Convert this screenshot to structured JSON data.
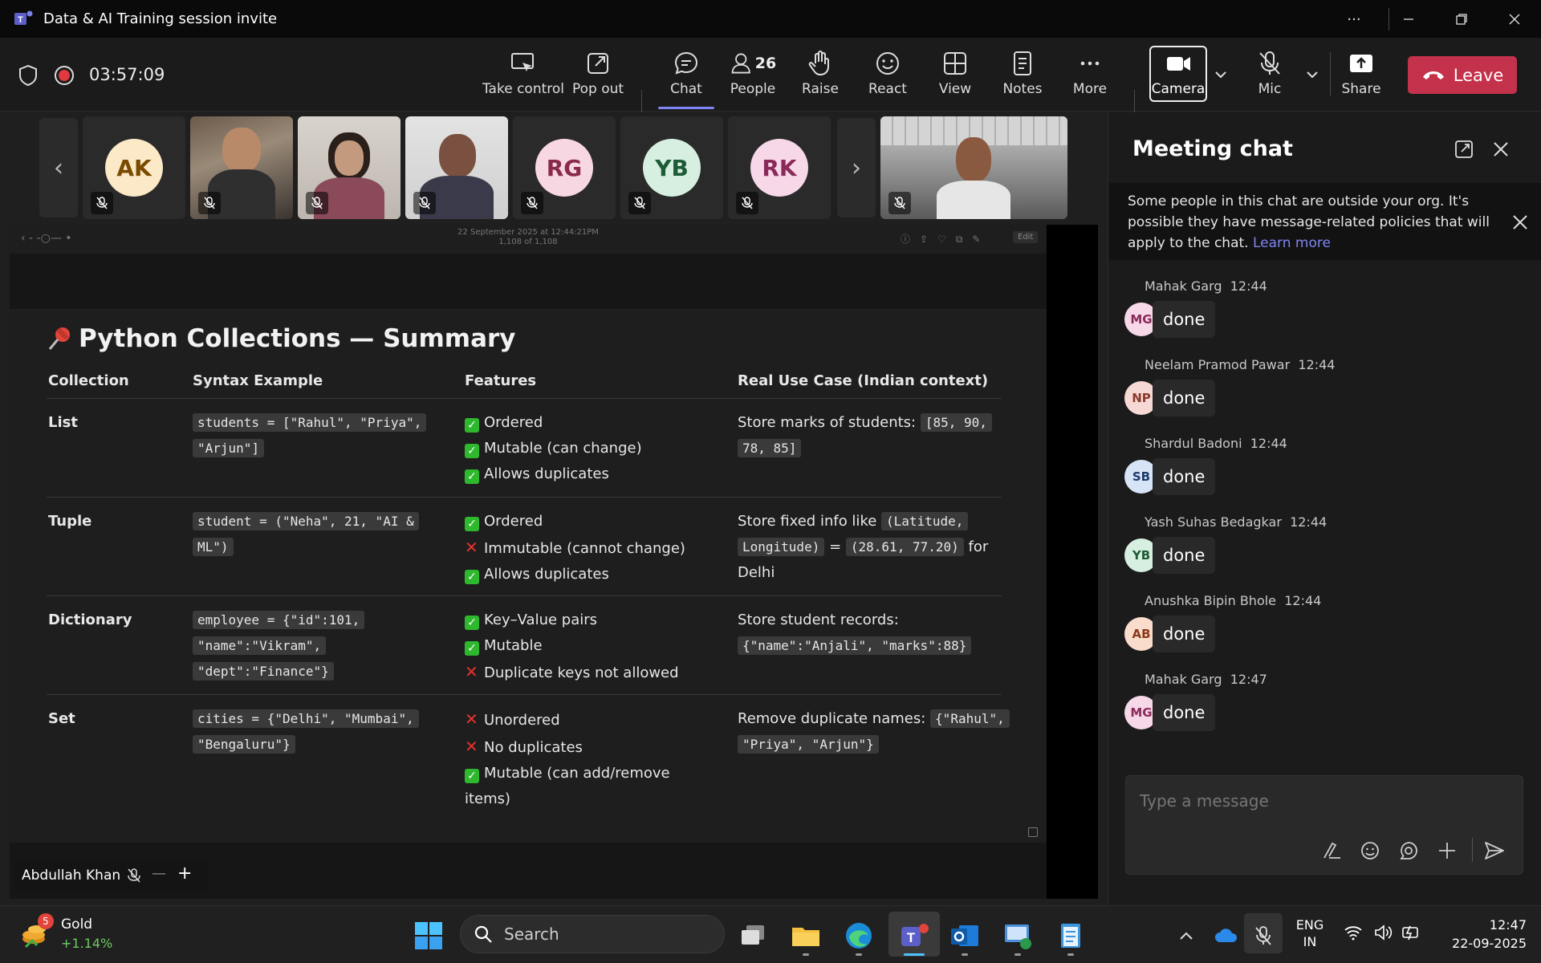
{
  "window": {
    "title": "Data & AI Training session invite"
  },
  "meeting": {
    "timer": "03:57:09",
    "toolbar": {
      "take_control": "Take control",
      "pop_out": "Pop out",
      "chat": "Chat",
      "people": "People",
      "people_count": "26",
      "raise": "Raise",
      "react": "React",
      "view": "View",
      "notes": "Notes",
      "more": "More",
      "camera": "Camera",
      "mic": "Mic",
      "share": "Share",
      "leave": "Leave"
    },
    "accent_color": "#7f85f5",
    "leave_color": "#c4314b"
  },
  "participants": [
    {
      "initials": "AK",
      "bg": "#fbe9c7",
      "fg": "#7a4a00",
      "type": "avatar"
    },
    {
      "initials": "",
      "type": "video"
    },
    {
      "initials": "",
      "type": "video"
    },
    {
      "initials": "",
      "type": "video"
    },
    {
      "initials": "RG",
      "bg": "#f7d8e2",
      "fg": "#8a2a4a",
      "type": "avatar"
    },
    {
      "initials": "YB",
      "bg": "#d6efe0",
      "fg": "#1d5a36",
      "type": "avatar"
    },
    {
      "initials": "RK",
      "bg": "#f7d8e8",
      "fg": "#8a2a5a",
      "type": "avatar"
    }
  ],
  "viewer": {
    "date_line1": "22 September 2025 at 12:44:21PM",
    "date_line2": "1,108 of 1,108",
    "edit": "Edit"
  },
  "slide": {
    "title": "Python Collections — Summary",
    "headers": [
      "Collection",
      "Syntax Example",
      "Features",
      "Real Use Case (Indian context)"
    ],
    "rows": [
      {
        "name": "List",
        "syntax": [
          "students = [\"Rahul\", \"Priya\",",
          "\"Arjun\"]"
        ],
        "features": [
          {
            "mark": "check",
            "text": "Ordered"
          },
          {
            "mark": "check",
            "text": "Mutable (can change)"
          },
          {
            "mark": "check",
            "text": "Allows duplicates"
          }
        ],
        "use_text": "Store marks of students:",
        "use_code1": "[85, 90,",
        "use_code2": "78, 85]"
      },
      {
        "name": "Tuple",
        "syntax": [
          "student = (\"Neha\", 21, \"AI &",
          "ML\")"
        ],
        "features": [
          {
            "mark": "check",
            "text": "Ordered"
          },
          {
            "mark": "cross",
            "text": "Immutable (cannot change)"
          },
          {
            "mark": "check",
            "text": "Allows duplicates"
          }
        ],
        "use_text": "Store fixed info like",
        "use_code1": "(Latitude,",
        "use_code2": "Longitude)",
        "use_eq": "=",
        "use_code3": "(28.61, 77.20)",
        "use_for": "for",
        "use_tail": "Delhi"
      },
      {
        "name": "Dictionary",
        "syntax": [
          "employee = {\"id\":101,",
          "\"name\":\"Vikram\",",
          "\"dept\":\"Finance\"}"
        ],
        "features": [
          {
            "mark": "check",
            "text": "Key–Value pairs"
          },
          {
            "mark": "check",
            "text": "Mutable"
          },
          {
            "mark": "cross",
            "text": "Duplicate keys not allowed"
          }
        ],
        "use_text": "Store student records:",
        "use_code1": "{\"name\":\"Anjali\", \"marks\":88}"
      },
      {
        "name": "Set",
        "syntax": [
          "cities = {\"Delhi\", \"Mumbai\",",
          "\"Bengaluru\"}"
        ],
        "features": [
          {
            "mark": "cross",
            "text": "Unordered"
          },
          {
            "mark": "cross",
            "text": "No duplicates"
          },
          {
            "mark": "check",
            "text": "Mutable (can add/remove"
          },
          {
            "mark": "none",
            "text": "items)"
          }
        ],
        "use_text": "Remove duplicate names:",
        "use_code1": "{\"Rahul\",",
        "use_code2": "\"Priya\", \"Arjun\"}"
      }
    ]
  },
  "presenter": {
    "name": "Abdullah Khan"
  },
  "chat": {
    "title": "Meeting chat",
    "notice": "Some people in this chat are outside your org. It's possible they have message-related policies that will apply to the chat.",
    "notice_link": "Learn more",
    "messages": [
      {
        "name": "Mahak Garg",
        "time": "12:44",
        "initials": "MG",
        "bg": "#f7d8e8",
        "fg": "#8a2a5a",
        "text": "done"
      },
      {
        "name": "Neelam Pramod Pawar",
        "time": "12:44",
        "initials": "NP",
        "bg": "#f6d9d4",
        "fg": "#8a3a2a",
        "text": "done"
      },
      {
        "name": "Shardul Badoni",
        "time": "12:44",
        "initials": "SB",
        "bg": "#d6e4f5",
        "fg": "#1d3a6a",
        "text": "done"
      },
      {
        "name": "Yash Suhas Bedagkar",
        "time": "12:44",
        "initials": "YB",
        "bg": "#d6efe0",
        "fg": "#1d5a36",
        "text": "done"
      },
      {
        "name": "Anushka Bipin Bhole",
        "time": "12:44",
        "initials": "AB",
        "bg": "#f9dccb",
        "fg": "#8a3a1a",
        "text": "done"
      },
      {
        "name": "Mahak Garg",
        "time": "12:47",
        "initials": "MG",
        "bg": "#f7d8e8",
        "fg": "#8a2a5a",
        "text": "done"
      }
    ],
    "compose_placeholder": "Type a message"
  },
  "taskbar": {
    "widget_name": "Gold",
    "widget_change": "+1.14%",
    "widget_badge": "5",
    "search_placeholder": "Search",
    "lang1": "ENG",
    "lang2": "IN",
    "time": "12:47",
    "date": "22-09-2025"
  }
}
